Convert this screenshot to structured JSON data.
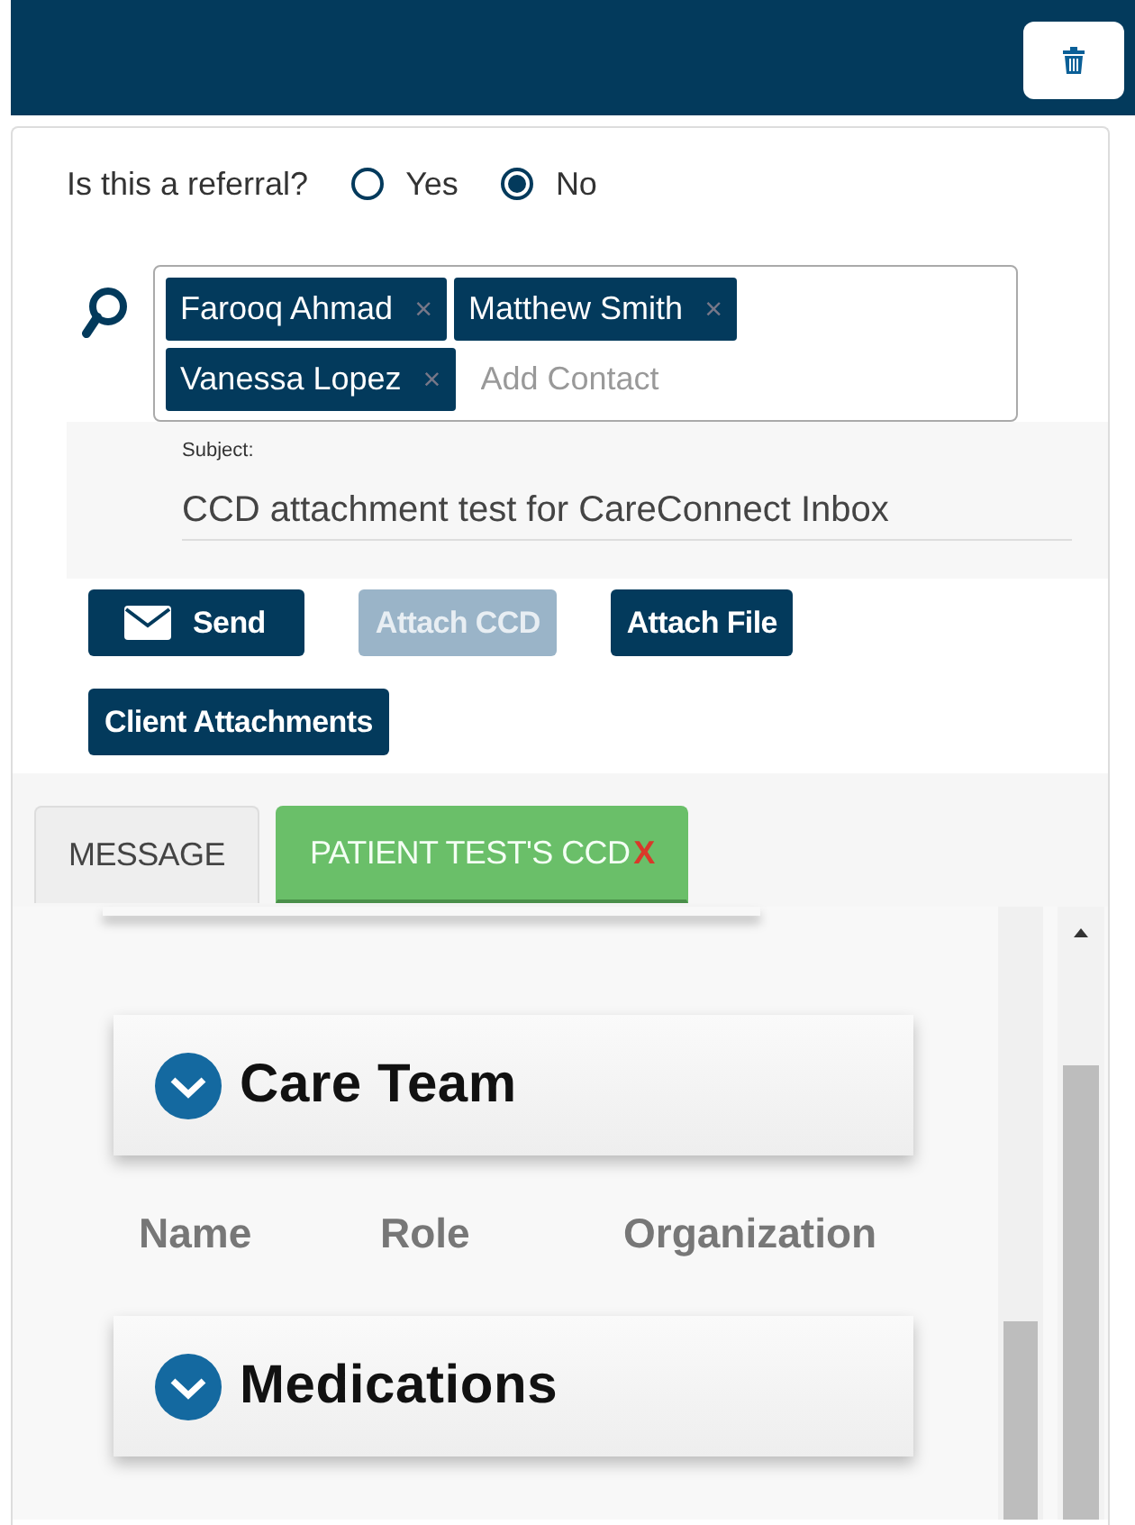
{
  "referral": {
    "question": "Is this a referral?",
    "options": [
      {
        "label": "Yes",
        "selected": false
      },
      {
        "label": "No",
        "selected": true
      }
    ]
  },
  "recipients": {
    "contacts": [
      {
        "name": "Farooq Ahmad",
        "remove": "×"
      },
      {
        "name": "Matthew Smith",
        "remove": "×"
      },
      {
        "name": "Vanessa Lopez",
        "remove": "×"
      }
    ],
    "placeholder": "Add Contact"
  },
  "subject": {
    "label": "Subject:",
    "value": "CCD attachment test for CareConnect Inbox"
  },
  "buttons": [
    {
      "label": "Send",
      "kind": "send",
      "disabled": false
    },
    {
      "label": "Attach CCD",
      "kind": "plain",
      "disabled": true
    },
    {
      "label": "Attach File",
      "kind": "plain",
      "disabled": false
    },
    {
      "label": "Client Attachments",
      "kind": "plain",
      "disabled": false
    }
  ],
  "tabs": [
    {
      "label": "MESSAGE",
      "selected": false
    },
    {
      "label": "PATIENT TEST'S CCD",
      "close": "X",
      "selected": true
    }
  ],
  "sections": [
    {
      "title": "Care Team",
      "columns": [
        "Name",
        "Role",
        "Organization"
      ]
    },
    {
      "title": "Medications"
    }
  ]
}
